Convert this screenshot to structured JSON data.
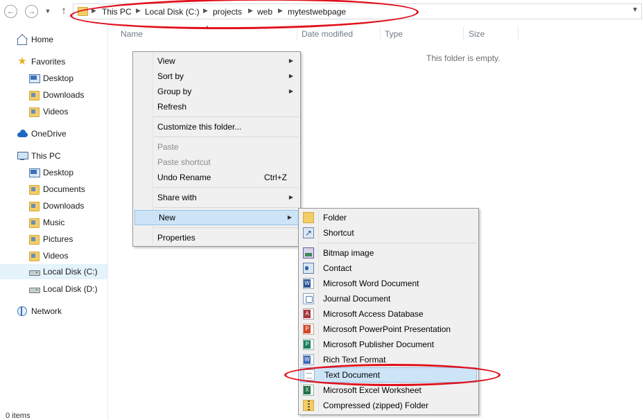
{
  "address_bar": {
    "breadcrumbs": [
      "This PC",
      "Local Disk (C:)",
      "projects",
      "web",
      "mytestwebpage"
    ]
  },
  "sidebar": {
    "items": [
      {
        "label": "Home",
        "icon": "home-icon"
      },
      {
        "label": "Favorites",
        "icon": "star-icon"
      },
      {
        "label": "Desktop",
        "icon": "desktop-icon"
      },
      {
        "label": "Downloads",
        "icon": "downloads-folder-icon"
      },
      {
        "label": "Videos",
        "icon": "videos-folder-icon"
      },
      {
        "label": "OneDrive",
        "icon": "onedrive-cloud-icon"
      },
      {
        "label": "This PC",
        "icon": "computer-icon"
      },
      {
        "label": "Desktop",
        "icon": "desktop-icon"
      },
      {
        "label": "Documents",
        "icon": "documents-folder-icon"
      },
      {
        "label": "Downloads",
        "icon": "downloads-folder-icon"
      },
      {
        "label": "Music",
        "icon": "music-folder-icon"
      },
      {
        "label": "Pictures",
        "icon": "pictures-folder-icon"
      },
      {
        "label": "Videos",
        "icon": "videos-folder-icon"
      },
      {
        "label": "Local Disk (C:)",
        "icon": "drive-icon",
        "selected": true
      },
      {
        "label": "Local Disk (D:)",
        "icon": "drive-icon"
      },
      {
        "label": "Network",
        "icon": "network-icon"
      }
    ]
  },
  "columns": [
    "Name",
    "Date modified",
    "Type",
    "Size"
  ],
  "empty_message": "This folder is empty.",
  "status_bar": "0 items",
  "context_menu": {
    "items": [
      {
        "label": "View",
        "submenu": true
      },
      {
        "label": "Sort by",
        "submenu": true
      },
      {
        "label": "Group by",
        "submenu": true
      },
      {
        "label": "Refresh"
      },
      {
        "label": "Customize this folder..."
      },
      {
        "label": "Paste",
        "disabled": true
      },
      {
        "label": "Paste shortcut",
        "disabled": true
      },
      {
        "label": "Undo Rename",
        "shortcut": "Ctrl+Z"
      },
      {
        "label": "Share with",
        "submenu": true
      },
      {
        "label": "New",
        "submenu": true,
        "highlighted": true
      },
      {
        "label": "Properties"
      }
    ]
  },
  "new_submenu": {
    "items": [
      {
        "label": "Folder",
        "icon": "folder-icon"
      },
      {
        "label": "Shortcut",
        "icon": "shortcut-icon"
      },
      {
        "label": "Bitmap image",
        "icon": "bitmap-image-icon"
      },
      {
        "label": "Contact",
        "icon": "contact-icon"
      },
      {
        "label": "Microsoft Word Document",
        "icon": "word-document-icon"
      },
      {
        "label": "Journal Document",
        "icon": "journal-document-icon"
      },
      {
        "label": "Microsoft Access Database",
        "icon": "access-database-icon"
      },
      {
        "label": "Microsoft PowerPoint Presentation",
        "icon": "powerpoint-icon"
      },
      {
        "label": "Microsoft Publisher Document",
        "icon": "publisher-icon"
      },
      {
        "label": "Rich Text Format",
        "icon": "rich-text-icon"
      },
      {
        "label": "Text Document",
        "icon": "text-document-icon",
        "highlighted": true
      },
      {
        "label": "Microsoft Excel Worksheet",
        "icon": "excel-icon"
      },
      {
        "label": "Compressed (zipped) Folder",
        "icon": "zip-folder-icon"
      }
    ]
  },
  "colors": {
    "annotation_red": "#e0101c",
    "highlight": "#cde4f7",
    "selected_sidebar": "#e5f3fb"
  }
}
